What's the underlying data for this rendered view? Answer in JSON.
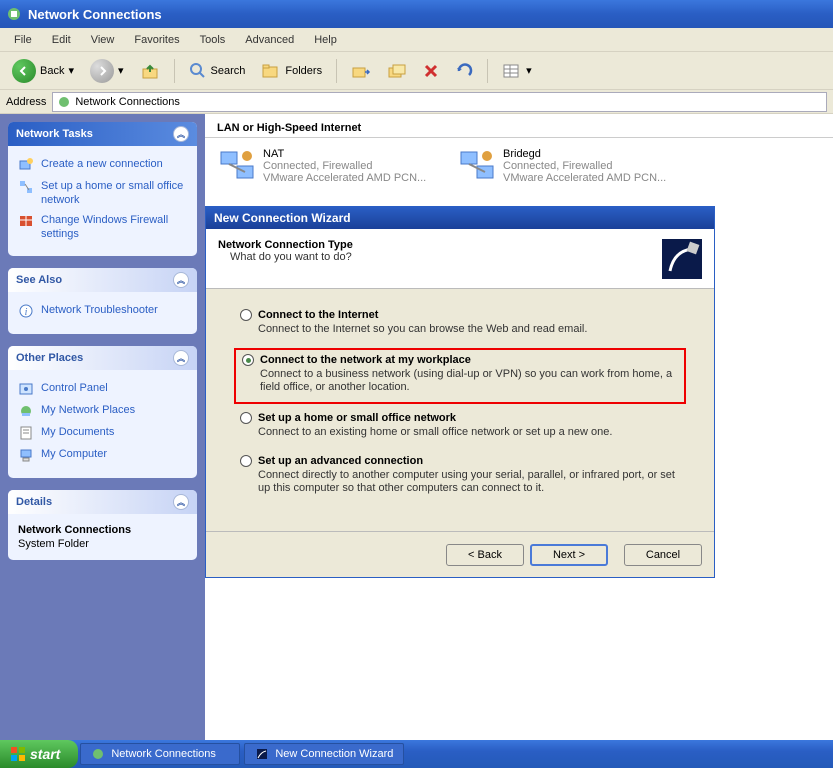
{
  "titlebar": {
    "title": "Network Connections"
  },
  "menu": {
    "file": "File",
    "edit": "Edit",
    "view": "View",
    "favorites": "Favorites",
    "tools": "Tools",
    "advanced": "Advanced",
    "help": "Help"
  },
  "toolbar": {
    "back": "Back",
    "search": "Search",
    "folders": "Folders"
  },
  "addressbar": {
    "label": "Address",
    "value": "Network Connections"
  },
  "sidebar": {
    "tasks": {
      "title": "Network Tasks",
      "items": [
        {
          "label": "Create a new connection"
        },
        {
          "label": "Set up a home or small office network"
        },
        {
          "label": "Change Windows Firewall settings"
        }
      ]
    },
    "seealso": {
      "title": "See Also",
      "items": [
        {
          "label": "Network Troubleshooter"
        }
      ]
    },
    "otherplaces": {
      "title": "Other Places",
      "items": [
        {
          "label": "Control Panel"
        },
        {
          "label": "My Network Places"
        },
        {
          "label": "My Documents"
        },
        {
          "label": "My Computer"
        }
      ]
    },
    "details": {
      "title": "Details",
      "name": "Network Connections",
      "type": "System Folder"
    }
  },
  "main": {
    "section": "LAN or High-Speed Internet",
    "connections": [
      {
        "name": "NAT",
        "status": "Connected, Firewalled",
        "device": "VMware Accelerated AMD PCN..."
      },
      {
        "name": "Bridegd",
        "status": "Connected, Firewalled",
        "device": "VMware Accelerated AMD PCN..."
      }
    ]
  },
  "wizard": {
    "title": "New Connection Wizard",
    "head_title": "Network Connection Type",
    "head_sub": "What do you want to do?",
    "options": [
      {
        "label": "Connect to the Internet",
        "desc": "Connect to the Internet so you can browse the Web and read email.",
        "selected": false
      },
      {
        "label": "Connect to the network at my workplace",
        "desc": "Connect to a business network (using dial-up or VPN) so you can work from home, a field office, or another location.",
        "selected": true,
        "highlight": true
      },
      {
        "label": "Set up a home or small office network",
        "desc": "Connect to an existing home or small office network or set up a new one.",
        "selected": false
      },
      {
        "label": "Set up an advanced connection",
        "desc": "Connect directly to another computer using your serial, parallel, or infrared port, or set up this computer so that other computers can connect to it.",
        "selected": false
      }
    ],
    "buttons": {
      "back": "< Back",
      "next": "Next >",
      "cancel": "Cancel"
    }
  },
  "taskbar": {
    "start": "start",
    "items": [
      {
        "label": "Network Connections"
      },
      {
        "label": "New Connection Wizard"
      }
    ]
  }
}
